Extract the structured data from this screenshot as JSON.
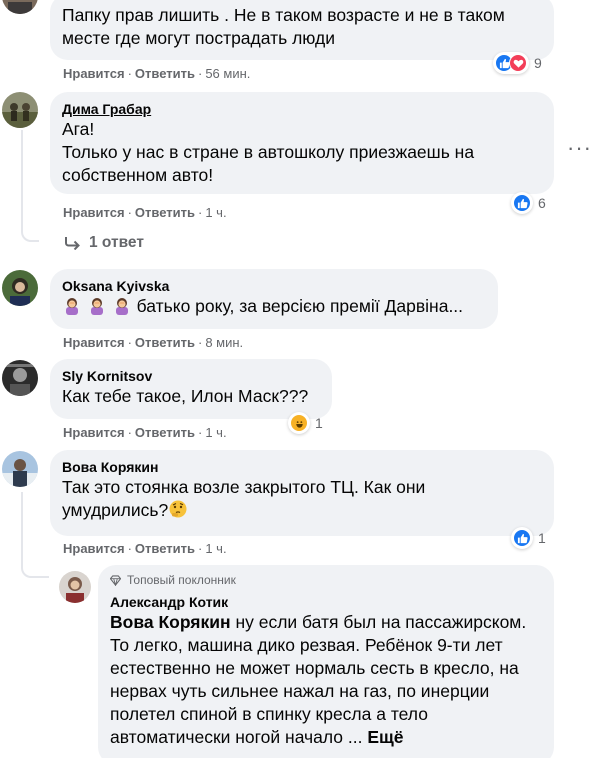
{
  "comments": [
    {
      "text": "Папку прав лишить . Не в таком возрасте и не в таком месте где могут пострадать люди",
      "like": "Нравится",
      "reply": "Ответить",
      "time": "56 мин.",
      "reactions": "9",
      "reaction_icons": [
        "like-icon",
        "love-icon"
      ]
    },
    {
      "author": "Дима Грабар",
      "text": "Ага!\nТолько у нас в стране в автошколу приезжаешь на собственном авто!",
      "like": "Нравится",
      "reply": "Ответить",
      "time": "1 ч.",
      "reactions": "6",
      "reaction_icons": [
        "like-icon"
      ],
      "replies_link": "1 ответ"
    },
    {
      "author": "Oksana Kyivska",
      "text": "батько року, за версією премії Дарвіна...",
      "emoji": "woman-facepalming-emoji ×3",
      "like": "Нравится",
      "reply": "Ответить",
      "time": "8 мин."
    },
    {
      "author": "Sly Kornitsov",
      "text": "Как тебе такое, Илон Маск???",
      "like": "Нравится",
      "reply": "Ответить",
      "time": "1 ч.",
      "reactions": "1",
      "reaction_icons": [
        "haha-icon"
      ]
    },
    {
      "author": "Вова Корякин",
      "text": "Так это стоянка возле закрытого ТЦ. Как они умудрились?",
      "emoji": "thinking-face-emoji",
      "like": "Нравится",
      "reply": "Ответить",
      "time": "1 ч.",
      "reactions": "1",
      "reaction_icons": [
        "like-icon"
      ]
    },
    {
      "badge": "Топовый поклонник",
      "author": "Александр Котик",
      "mention": "Вова Корякин",
      "text": " ну если батя был на пассажирском. То легко, машина дико резвая. Ребёнок 9-ти лет естественно не может нормаль сесть в кресло, на нервах чуть сильнее нажал на газ, по инерции полетел спиной в спинку кресла а тело автоматически ногой начало ... ",
      "see_more": "Ещё"
    }
  ],
  "more_options": "···",
  "colors": {
    "bubble": "#f0f2f5",
    "meta": "#65676b",
    "like": "#1877f2",
    "love": "#f33e58",
    "haha": "#f7b125"
  }
}
